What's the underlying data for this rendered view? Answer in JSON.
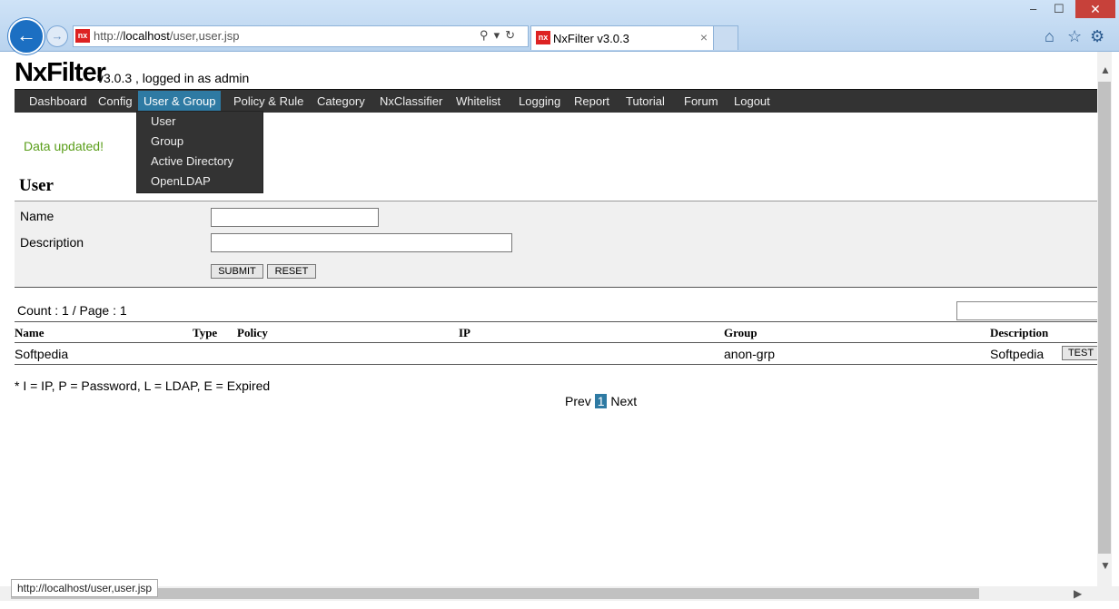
{
  "browser": {
    "url_prefix": "http://",
    "url_host": "localhost",
    "url_path": "/user,user.jsp",
    "tab_title": "NxFilter v3.0.3",
    "tab_icon": "nx",
    "tab_close": "×",
    "win_min": "‒",
    "win_max": "☐",
    "win_close": "✕",
    "status_url": "http://localhost/user,user.jsp"
  },
  "page": {
    "brand": "NxFilter",
    "version_text": "v3.0.3 , logged in as admin",
    "message": "Data updated!",
    "heading": "User"
  },
  "menu": {
    "items": [
      "Dashboard",
      "Config",
      "User & Group",
      "Policy & Rule",
      "Category",
      "NxClassifier",
      "Whitelist",
      "Logging",
      "Report",
      "Tutorial",
      "Forum",
      "Logout"
    ],
    "dropdown": [
      "User",
      "Group",
      "Active Directory",
      "OpenLDAP"
    ]
  },
  "form": {
    "name_label": "Name",
    "description_label": "Description",
    "name_value": "",
    "description_value": "",
    "submit_label": "SUBMIT",
    "reset_label": "RESET"
  },
  "list": {
    "count_text": "Count : 1 / Page : 1",
    "search_value": "",
    "columns": [
      "Name",
      "Type",
      "Policy",
      "IP",
      "Group",
      "Description"
    ],
    "rows": [
      {
        "name": "Softpedia",
        "type": "",
        "policy": "",
        "ip": "",
        "group": "anon-grp",
        "description": "Softpedia",
        "action": "TEST"
      }
    ],
    "legend": "* I = IP, P = Password, L = LDAP, E = Expired",
    "prev": "Prev",
    "current_page": "1",
    "next": "Next"
  }
}
